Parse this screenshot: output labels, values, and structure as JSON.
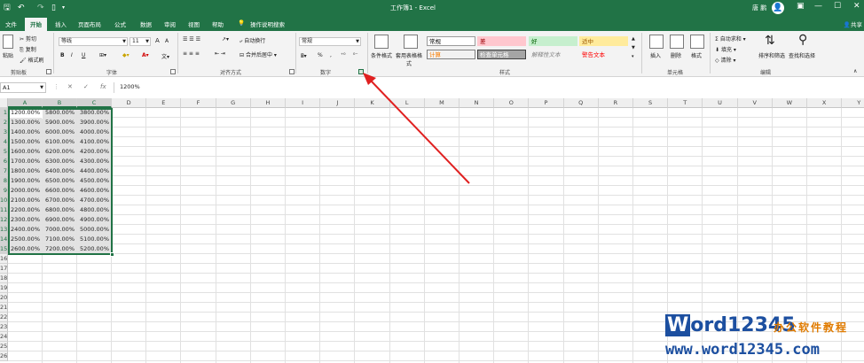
{
  "titlebar": {
    "doc_title": "工作簿1 - Excel",
    "user": "唐 鹏",
    "avatar_glyph": "◯",
    "save_icon": "save-icon",
    "undo_icon": "undo-icon",
    "redo_icon": "redo-icon",
    "new_icon": "new-document-icon",
    "restore_icon": "ribbon-display-icon",
    "minimize": "—",
    "maximize": "☐",
    "close": "✕"
  },
  "tabs": [
    {
      "label": "文件",
      "active": false
    },
    {
      "label": "开始",
      "active": true
    },
    {
      "label": "插入",
      "active": false
    },
    {
      "label": "页面布局",
      "active": false
    },
    {
      "label": "公式",
      "active": false
    },
    {
      "label": "数据",
      "active": false
    },
    {
      "label": "审阅",
      "active": false
    },
    {
      "label": "视图",
      "active": false
    },
    {
      "label": "帮助",
      "active": false
    }
  ],
  "tell_me": "操作说明搜索",
  "share": "共享",
  "ribbon": {
    "clipboard": {
      "paste": "粘贴",
      "cut": "剪切",
      "copy": "复制",
      "format_painter": "格式刷",
      "group": "剪贴板"
    },
    "font": {
      "name": "等线",
      "size": "11",
      "bold": "B",
      "italic": "I",
      "underline": "U",
      "grow": "A",
      "shrink": "A",
      "group": "字体"
    },
    "alignment": {
      "wrap": "自动换行",
      "merge": "合并后居中",
      "group": "对齐方式"
    },
    "number": {
      "format": "常规",
      "percent": "%",
      "comma": ",",
      "group": "数字"
    },
    "styles": {
      "conditional": "条件格式",
      "table": "套用表格格式",
      "cells": [
        {
          "label": "常规",
          "bg": "#ffffff",
          "color": "#000000",
          "border": "#9a9a9a"
        },
        {
          "label": "差",
          "bg": "#ffc7ce",
          "color": "#9c0006",
          "border": "#ffc7ce"
        },
        {
          "label": "好",
          "bg": "#c6efce",
          "color": "#006100",
          "border": "#c6efce"
        },
        {
          "label": "适中",
          "bg": "#ffeb9c",
          "color": "#9c5700",
          "border": "#ffeb9c"
        },
        {
          "label": "计算",
          "bg": "#f2f2f2",
          "color": "#fa7d00",
          "border": "#7f7f7f"
        },
        {
          "label": "检查单元格",
          "bg": "#a5a5a5",
          "color": "#ffffff",
          "border": "#3f3f3f"
        },
        {
          "label": "解释性文本",
          "bg": "#f3f3f3",
          "color": "#7f7f7f",
          "border": "#f3f3f3"
        },
        {
          "label": "警告文本",
          "bg": "#f3f3f3",
          "color": "#ff0000",
          "border": "#f3f3f3"
        }
      ],
      "group": "样式"
    },
    "cells_group": {
      "insert": "插入",
      "delete": "删除",
      "format": "格式",
      "group": "单元格"
    },
    "editing": {
      "autosum": "自动求和",
      "fill": "填充",
      "clear": "清除",
      "sort": "排序和筛选",
      "find": "查找和选择",
      "group": "编辑"
    }
  },
  "formula_bar": {
    "name_box": "A1",
    "fx": "fx",
    "content": "1200%"
  },
  "sheet": {
    "columns": [
      "A",
      "B",
      "C",
      "D",
      "E",
      "F",
      "G",
      "H",
      "I",
      "J",
      "K",
      "L",
      "M",
      "N",
      "O",
      "P",
      "Q",
      "R",
      "S",
      "T",
      "U",
      "V",
      "W",
      "X",
      "Y"
    ],
    "selected_columns": [
      "A",
      "B",
      "C"
    ],
    "row_count": 26,
    "data": [
      [
        "1200.00%",
        "5800.00%",
        "3800.00%"
      ],
      [
        "1300.00%",
        "5900.00%",
        "3900.00%"
      ],
      [
        "1400.00%",
        "6000.00%",
        "4000.00%"
      ],
      [
        "1500.00%",
        "6100.00%",
        "4100.00%"
      ],
      [
        "1600.00%",
        "6200.00%",
        "4200.00%"
      ],
      [
        "1700.00%",
        "6300.00%",
        "4300.00%"
      ],
      [
        "1800.00%",
        "6400.00%",
        "4400.00%"
      ],
      [
        "1900.00%",
        "6500.00%",
        "4500.00%"
      ],
      [
        "2000.00%",
        "6600.00%",
        "4600.00%"
      ],
      [
        "2100.00%",
        "6700.00%",
        "4700.00%"
      ],
      [
        "2200.00%",
        "6800.00%",
        "4800.00%"
      ],
      [
        "2300.00%",
        "6900.00%",
        "4900.00%"
      ],
      [
        "2400.00%",
        "7000.00%",
        "5000.00%"
      ],
      [
        "2500.00%",
        "7100.00%",
        "5100.00%"
      ],
      [
        "2600.00%",
        "7200.00%",
        "5200.00%"
      ]
    ]
  },
  "annotation": {
    "color": "#e02020"
  },
  "watermark": {
    "brand_boxed": "W",
    "brand_rest": "ord12345",
    "tagline": "办公软件教程",
    "url": "www.word12345.com"
  }
}
